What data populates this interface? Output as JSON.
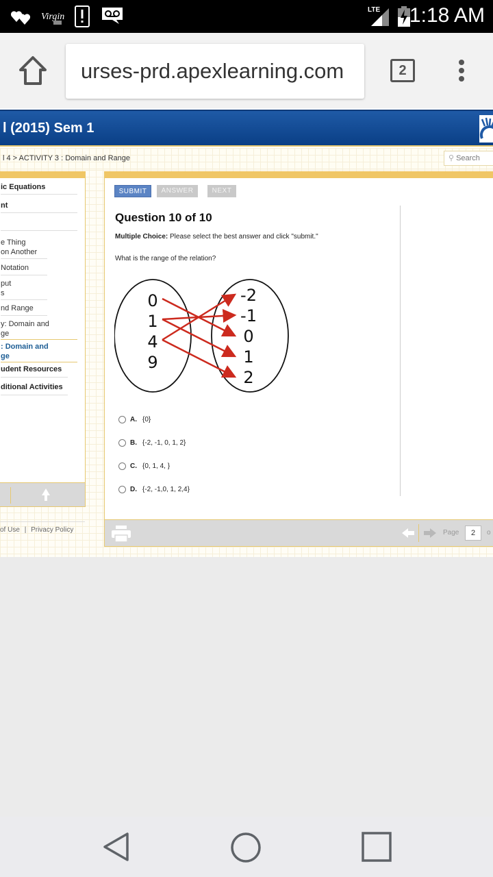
{
  "status_bar": {
    "left_icons": [
      "hearts-icon",
      "virgin-logo-icon",
      "alert-notification-icon",
      "voicemail-icon"
    ],
    "network": "LTE",
    "time": "1:18 AM"
  },
  "browser": {
    "url": "urses-prd.apexlearning.com",
    "tab_count": "2"
  },
  "banner": {
    "course_title": "l (2015) Sem 1"
  },
  "breadcrumb": {
    "text": "l 4 > ACTIVITY 3 : Domain and Range"
  },
  "search": {
    "placeholder": "Search"
  },
  "sidebar": {
    "items": [
      {
        "label": "ic Equations",
        "style": "bold"
      },
      {
        "label": "nt",
        "style": "bold"
      },
      {
        "label": "",
        "style": "normal"
      },
      {
        "label": "e Thing",
        "label2": "on Another",
        "style": "normal"
      },
      {
        "label": "Notation",
        "style": "normal"
      },
      {
        "label": "put",
        "label2": "s",
        "style": "normal"
      },
      {
        "label": "nd Range",
        "style": "normal"
      },
      {
        "label": "y: Domain and",
        "label2": "ge",
        "style": "normal"
      },
      {
        "label": ": Domain and",
        "label2": "ge",
        "style": "active"
      },
      {
        "label": "udent Resources",
        "style": "bold"
      },
      {
        "label": "ditional Activities",
        "style": "bold"
      }
    ]
  },
  "footer": {
    "terms": "of Use",
    "separator": "|",
    "privacy": "Privacy Policy"
  },
  "toolbar": {
    "submit_label": "SUBMIT",
    "answer_label": "ANSWER",
    "next_label": "NEXT"
  },
  "question": {
    "title": "Question 10 of 10",
    "instruction_bold": "Multiple Choice:",
    "instruction": " Please select the best answer and click \"submit.\"",
    "text": "What is the range of the relation?"
  },
  "mapping_diagram": {
    "domain": [
      "0",
      "1",
      "4",
      "9"
    ],
    "range": [
      "-2",
      "-1",
      "0",
      "1",
      "2"
    ],
    "arrows": [
      {
        "from": "0",
        "to": "0"
      },
      {
        "from": "1",
        "to": "-1"
      },
      {
        "from": "1",
        "to": "1"
      },
      {
        "from": "4",
        "to": "-2"
      },
      {
        "from": "4",
        "to": "2"
      }
    ],
    "arrow_color": "#cc2a1e"
  },
  "choices": [
    {
      "letter": "A.",
      "text": "{0}"
    },
    {
      "letter": "B.",
      "text": "{-2, -1, 0, 1, 2}"
    },
    {
      "letter": "C.",
      "text": "{0, 1, 4, }"
    },
    {
      "letter": "D.",
      "text": "{-2, -1,0, 1, 2,4}"
    }
  ],
  "pager": {
    "page_label": "Page",
    "page_value": "2",
    "of_label": "o"
  },
  "colors": {
    "banner": "#0a3f86",
    "accent_gold": "#f0c665",
    "submit_blue": "#5b84c4",
    "active_link": "#1d5d94"
  }
}
